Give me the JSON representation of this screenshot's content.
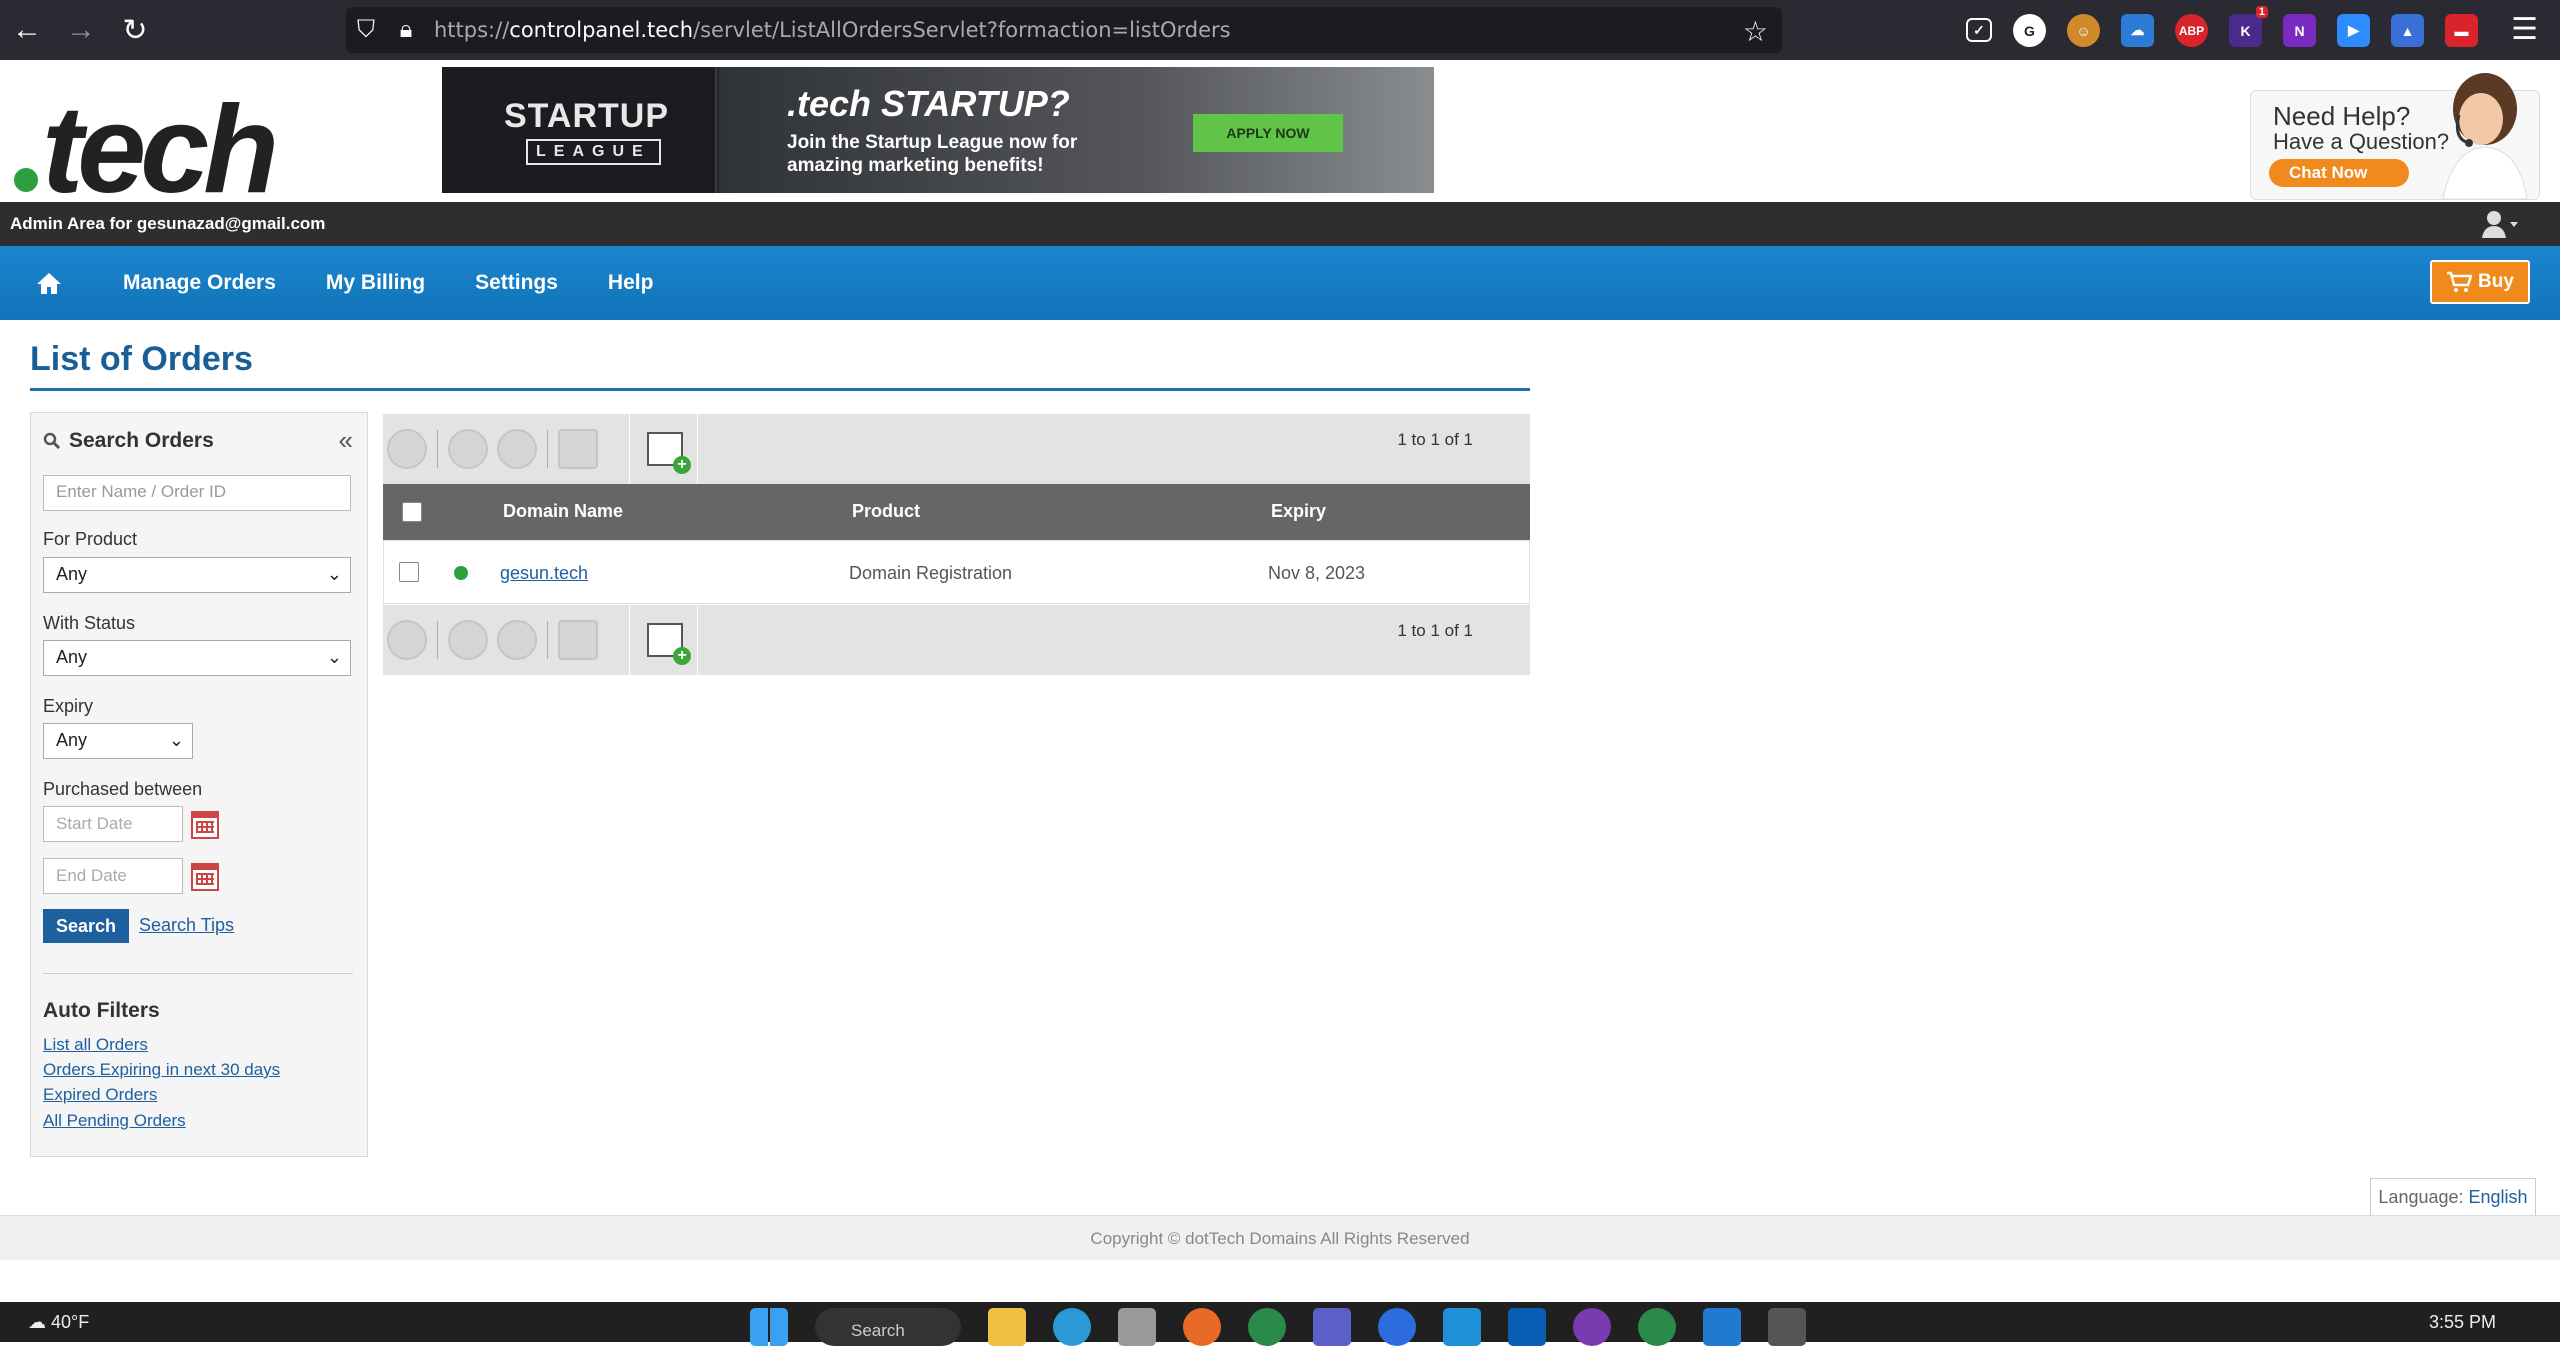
{
  "browser": {
    "url_prefix": "https://",
    "url_domain": "controlpanel.tech",
    "url_path": "/servlet/ListAllOrdersServlet?formaction=listOrders",
    "extension_badge": "1",
    "abp_label": "ABP"
  },
  "header": {
    "logo_text": "tech",
    "banner": {
      "brand_line1": "STARTUP",
      "brand_line2": "LEAGUE",
      "headline": ".tech STARTUP?",
      "body": "Join the Startup League now for amazing marketing benefits!",
      "cta": "APPLY NOW"
    },
    "help": {
      "title": "Need Help?",
      "subtitle": "Have a Question?",
      "chat": "Chat Now"
    }
  },
  "adminbar": {
    "text": "Admin Area for gesunazad@gmail.com"
  },
  "nav": {
    "items": [
      "Manage Orders",
      "My Billing",
      "Settings",
      "Help"
    ],
    "buy": "Buy"
  },
  "page": {
    "title": "List of Orders"
  },
  "sidebar": {
    "heading": "Search Orders",
    "search_placeholder": "Enter Name / Order ID",
    "product_label": "For Product",
    "product_value": "Any",
    "status_label": "With Status",
    "status_value": "Any",
    "expiry_label": "Expiry",
    "expiry_value": "Any",
    "purchased_label": "Purchased between",
    "start_placeholder": "Start Date",
    "end_placeholder": "End Date",
    "search_button": "Search",
    "tips_link": "Search Tips",
    "auto_filters_heading": "Auto Filters",
    "auto_filters": [
      "List all Orders",
      "Orders Expiring in next 30 days",
      "Expired Orders",
      "All Pending Orders"
    ]
  },
  "orders": {
    "pager": "1 to 1 of 1",
    "columns": [
      "Domain Name",
      "Product",
      "Expiry"
    ],
    "rows": [
      {
        "domain": "gesun.tech",
        "product": "Domain Registration",
        "expiry": "Nov 8, 2023",
        "status_color": "#2e9f3f"
      }
    ]
  },
  "footer": {
    "language_label": "Language:",
    "language_value": "English",
    "copyright": "Copyright © dotTech Domains All Rights Reserved"
  },
  "taskbar": {
    "weather": "40°F",
    "search": "Search",
    "time": "3:55 PM"
  },
  "colors": {
    "brand_blue": "#1a86cf",
    "title_blue": "#1a5e97",
    "accent_orange": "#f08a1c",
    "status_green": "#2e9f3f"
  }
}
